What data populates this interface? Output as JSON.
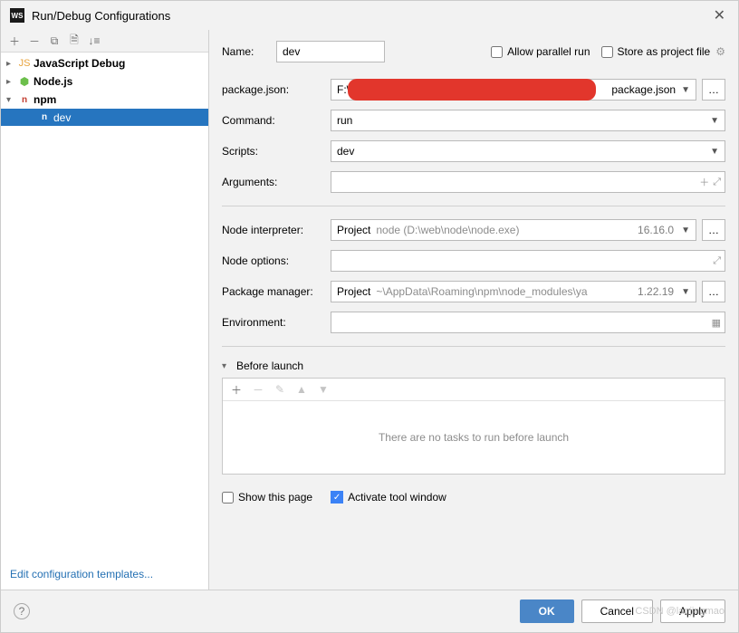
{
  "title": "Run/Debug Configurations",
  "tree": {
    "items": [
      {
        "label": "JavaScript Debug"
      },
      {
        "label": "Node.js"
      },
      {
        "label": "npm"
      }
    ],
    "selected_child": "dev"
  },
  "left_footer_link": "Edit configuration templates...",
  "form": {
    "name_label": "Name:",
    "name_value": "dev",
    "allow_parallel_label": "Allow parallel run",
    "store_label": "Store as project file",
    "package_json_label": "package.json:",
    "package_json_value_prefix": "F:\\",
    "package_json_value_suffix": "package.json",
    "command_label": "Command:",
    "command_value": "run",
    "scripts_label": "Scripts:",
    "scripts_value": "dev",
    "arguments_label": "Arguments:",
    "node_interp_label": "Node interpreter:",
    "node_interp_prefix": "Project",
    "node_interp_path": "node (D:\\web\\node\\node.exe)",
    "node_interp_version": "16.16.0",
    "node_options_label": "Node options:",
    "pkg_mgr_label": "Package manager:",
    "pkg_mgr_prefix": "Project",
    "pkg_mgr_path": "~\\AppData\\Roaming\\npm\\node_modules\\ya",
    "pkg_mgr_version": "1.22.19",
    "env_label": "Environment:",
    "before_launch_label": "Before launch",
    "before_launch_empty": "There are no tasks to run before launch",
    "show_this_page": "Show this page",
    "activate_tool_window": "Activate tool window"
  },
  "footer": {
    "ok": "OK",
    "cancel": "Cancel",
    "apply": "Apply",
    "watermark": "CSDN @lanjingmao"
  }
}
